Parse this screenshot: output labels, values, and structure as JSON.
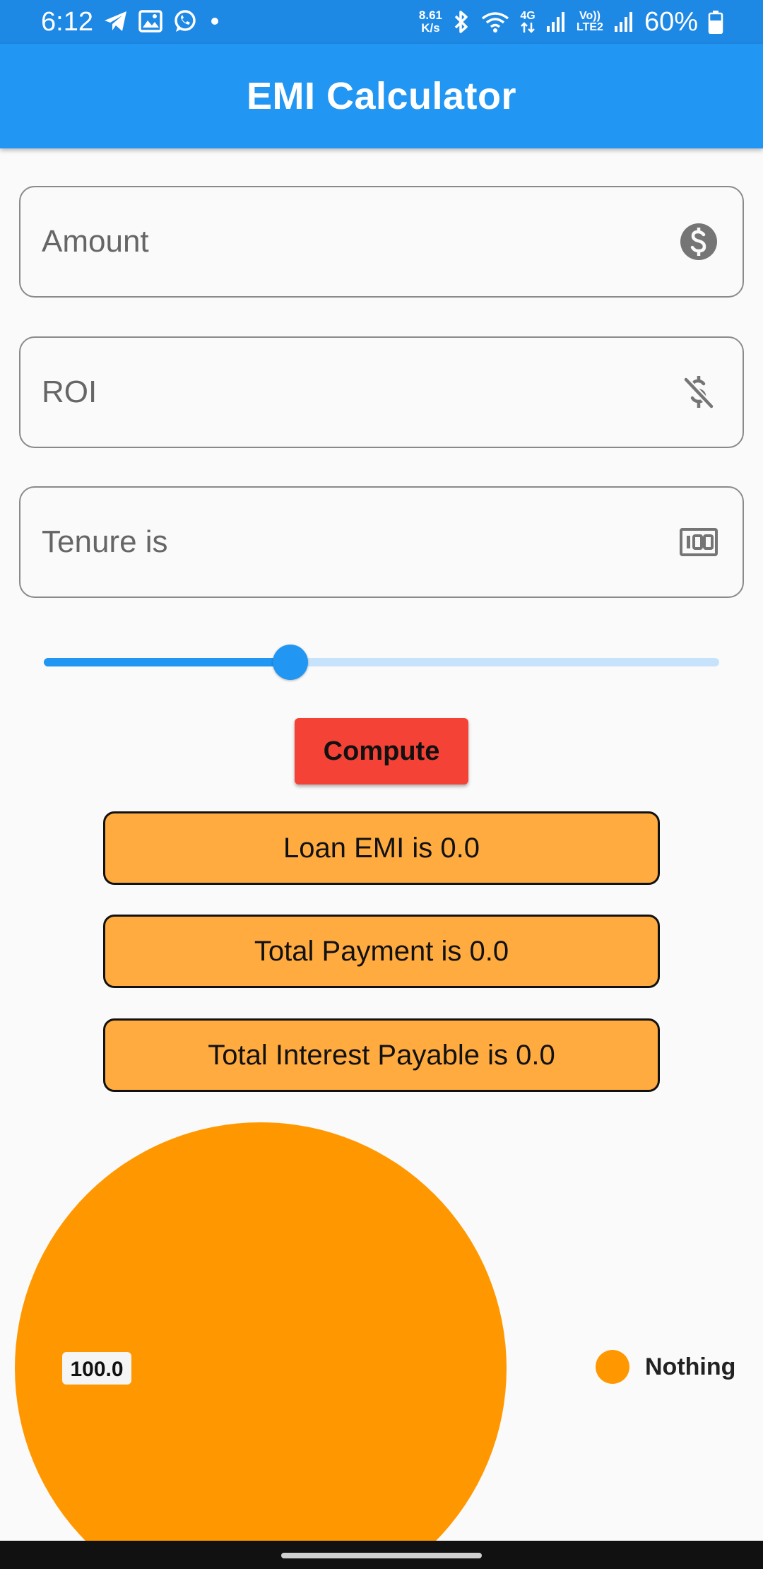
{
  "status_bar": {
    "time": "6:12",
    "net_speed_value": "8.61",
    "net_speed_unit": "K/s",
    "network_4g": "4G",
    "volte_label": "Vo))",
    "lte_label": "LTE2",
    "battery_percent": "60%"
  },
  "app_bar": {
    "title": "EMI Calculator"
  },
  "fields": {
    "amount": {
      "placeholder": "Amount",
      "value": "",
      "icon": "dollar-circle-icon"
    },
    "roi": {
      "placeholder": "ROI",
      "value": "",
      "icon": "money-off-icon"
    },
    "tenure": {
      "placeholder": "Tenure is",
      "value": "",
      "icon": "hundred-icon"
    }
  },
  "slider": {
    "value_fraction": 0.365
  },
  "compute_button": {
    "label": "Compute"
  },
  "results": {
    "loan_emi": "Loan EMI is 0.0",
    "total_payment": "Total Payment is 0.0",
    "total_interest": "Total Interest Payable is 0.0"
  },
  "colors": {
    "status_bar": "#1e88e5",
    "app_bar": "#2196f3",
    "compute_button": "#f44336",
    "result_box": "#ffab40",
    "pie_slice": "#ff9800",
    "slider_active": "#2196f3",
    "slider_inactive": "#c7e3fb"
  },
  "chart_data": {
    "type": "pie",
    "slices": [
      {
        "label": "Nothing",
        "value": 100.0,
        "display": "100.0",
        "color": "#ff9800"
      }
    ],
    "legend": [
      "Nothing"
    ],
    "legend_position": "right"
  }
}
